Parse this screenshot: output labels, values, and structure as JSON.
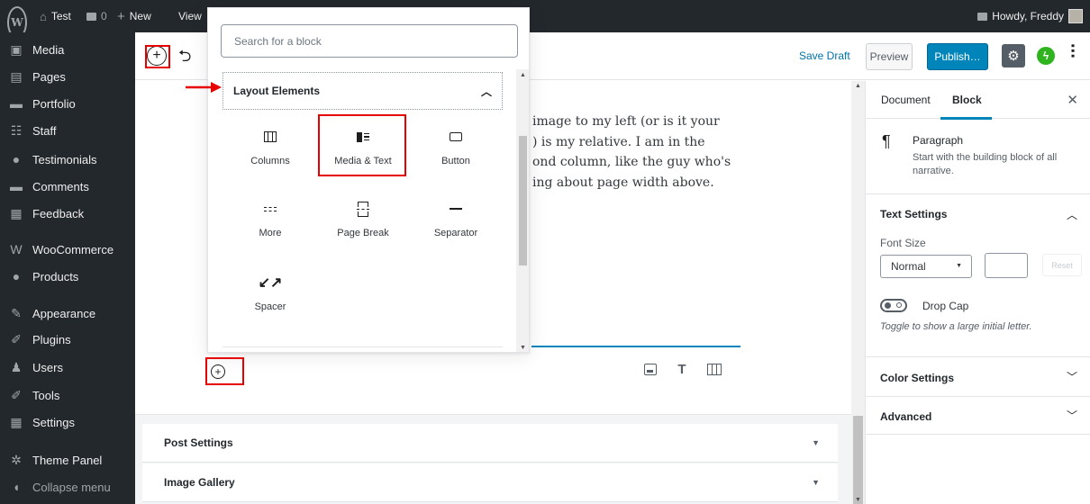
{
  "admin_bar": {
    "logo": "W",
    "site_name": "Test",
    "comment_count": "0",
    "new_label": "New",
    "view_label": "View",
    "howdy": "Howdy, Freddy"
  },
  "admin_menu": [
    {
      "label": "Media",
      "icon": "media-icon"
    },
    {
      "label": "Pages",
      "icon": "pages-icon"
    },
    {
      "label": "Portfolio",
      "icon": "portfolio-icon"
    },
    {
      "label": "Staff",
      "icon": "staff-icon"
    },
    {
      "label": "Testimonials",
      "icon": "testimonials-icon"
    },
    {
      "label": "Comments",
      "icon": "comments-icon"
    },
    {
      "label": "Feedback",
      "icon": "feedback-icon"
    },
    {
      "label": "WooCommerce",
      "icon": "woocommerce-icon"
    },
    {
      "label": "Products",
      "icon": "products-icon"
    },
    {
      "label": "Appearance",
      "icon": "appearance-icon"
    },
    {
      "label": "Plugins",
      "icon": "plugins-icon"
    },
    {
      "label": "Users",
      "icon": "users-icon"
    },
    {
      "label": "Tools",
      "icon": "tools-icon"
    },
    {
      "label": "Settings",
      "icon": "settings-icon"
    },
    {
      "label": "Theme Panel",
      "icon": "theme-panel-icon"
    },
    {
      "label": "Collapse menu",
      "icon": "collapse-icon"
    }
  ],
  "header": {
    "save_draft": "Save Draft",
    "preview": "Preview",
    "publish": "Publish…"
  },
  "content": {
    "paragraph_lines": [
      "image to my left (or is it your",
      ") is my relative. I am in the",
      "ond column, like the guy who's",
      "ing about page width above."
    ]
  },
  "inserter": {
    "search_placeholder": "Search for a block",
    "panel_title": "Layout Elements",
    "blocks": [
      {
        "label": "Columns",
        "icon": "columns-icon"
      },
      {
        "label": "Media & Text",
        "icon": "media-text-icon",
        "highlighted": true
      },
      {
        "label": "Button",
        "icon": "button-icon"
      },
      {
        "label": "More",
        "icon": "more-icon"
      },
      {
        "label": "Page Break",
        "icon": "page-break-icon"
      },
      {
        "label": "Separator",
        "icon": "separator-icon"
      },
      {
        "label": "Spacer",
        "icon": "spacer-icon"
      }
    ]
  },
  "metaboxes": [
    {
      "title": "Post Settings"
    },
    {
      "title": "Image Gallery"
    }
  ],
  "sidebar": {
    "tab_document": "Document",
    "tab_block": "Block",
    "block_title": "Paragraph",
    "block_description": "Start with the building block of all narrative.",
    "text_settings": "Text Settings",
    "font_size_label": "Font Size",
    "font_size_value": "Normal",
    "reset": "Reset",
    "drop_cap": "Drop Cap",
    "drop_cap_help": "Toggle to show a large initial letter.",
    "color_settings": "Color Settings",
    "advanced": "Advanced"
  },
  "colors": {
    "admin_dark": "#23282d",
    "accent": "#0085ba",
    "highlight": "#e60000"
  }
}
